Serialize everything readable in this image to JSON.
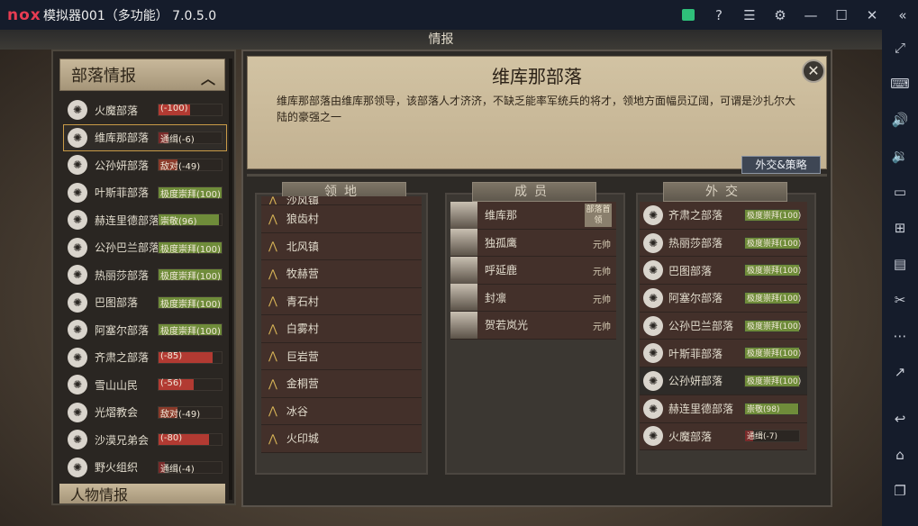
{
  "window": {
    "logo": "nox",
    "title": "模拟器001（多功能） 7.0.5.0",
    "toolbar_icons": [
      "gift-icon",
      "help-icon",
      "menu-icon",
      "settings-icon",
      "minimize-icon",
      "maximize-icon",
      "close-icon",
      "collapse-icon"
    ]
  },
  "sidebar_icons": [
    "fullscreen-icon",
    "keyboard-icon",
    "volume-up-icon",
    "volume-down-icon",
    "screen-icon",
    "apk-install-icon",
    "multi-instance-icon",
    "scissors-icon",
    "more-icon",
    "share-icon",
    "back-icon",
    "home-icon",
    "recent-apps-icon"
  ],
  "game": {
    "header": "情报",
    "left_panel": {
      "title": "部落情报",
      "next_section": "人物情报",
      "tribes": [
        {
          "name": "火魔部落",
          "relation": "(-100)",
          "color": "#b23a32",
          "level": 0.5,
          "selected": false
        },
        {
          "name": "维库那部落",
          "relation": "通缉(-6)",
          "color": "#7a2a2a",
          "level": 0.15,
          "selected": true
        },
        {
          "name": "公孙妍部落",
          "relation": "敌对(-49)",
          "color": "#8a3a2a",
          "level": 0.3,
          "selected": false
        },
        {
          "name": "叶斯菲部落",
          "relation": "极度崇拜(100)",
          "color": "#6f8c3a",
          "level": 1.0,
          "selected": false
        },
        {
          "name": "赫连里德部落",
          "relation": "崇敬(96)",
          "color": "#6f8c3a",
          "level": 0.96,
          "selected": false
        },
        {
          "name": "公孙巴兰部落",
          "relation": "极度崇拜(100)",
          "color": "#6f8c3a",
          "level": 1.0,
          "selected": false
        },
        {
          "name": "热丽莎部落",
          "relation": "极度崇拜(100)",
          "color": "#6f8c3a",
          "level": 1.0,
          "selected": false
        },
        {
          "name": "巴图部落",
          "relation": "极度崇拜(100)",
          "color": "#6f8c3a",
          "level": 1.0,
          "selected": false
        },
        {
          "name": "阿塞尔部落",
          "relation": "极度崇拜(100)",
          "color": "#6f8c3a",
          "level": 1.0,
          "selected": false
        },
        {
          "name": "齐肃之部落",
          "relation": "(-85)",
          "color": "#b23a32",
          "level": 0.85,
          "selected": false
        },
        {
          "name": "雪山山民",
          "relation": "(-56)",
          "color": "#b23a32",
          "level": 0.56,
          "selected": false
        },
        {
          "name": "光熠教会",
          "relation": "敌对(-49)",
          "color": "#8a3a2a",
          "level": 0.3,
          "selected": false
        },
        {
          "name": "沙漠兄弟会",
          "relation": "(-80)",
          "color": "#b23a32",
          "level": 0.8,
          "selected": false
        },
        {
          "name": "野火组织",
          "relation": "通缉(-4)",
          "color": "#7a2a2a",
          "level": 0.1,
          "selected": false
        }
      ]
    },
    "detail": {
      "name": "维库那部落",
      "description": "维库那部落由维库那领导，该部落人才济济，不缺乏能率军统兵的将才，领地方面幅员辽阔，可谓是沙扎尔大陆的豪强之一",
      "diplomacy_button": "外交&策略",
      "territory": {
        "title": "领地",
        "items": [
          "沙风镇",
          "狼齿村",
          "北风镇",
          "牧赫营",
          "青石村",
          "白雾村",
          "巨岩营",
          "金桐营",
          "冰谷",
          "火印城"
        ]
      },
      "members": {
        "title": "成员",
        "items": [
          {
            "name": "维库那",
            "role": "部落首领"
          },
          {
            "name": "独孤鹰",
            "role": "元帅"
          },
          {
            "name": "呼延鹿",
            "role": "元帅"
          },
          {
            "name": "封凛",
            "role": "元帅"
          },
          {
            "name": "贺若岚光",
            "role": "元帅"
          }
        ]
      },
      "foreign": {
        "title": "外交",
        "items": [
          {
            "name": "齐肃之部落",
            "relation": "极度崇拜(100)",
            "color": "#6f8c3a",
            "level": 1.0
          },
          {
            "name": "热丽莎部落",
            "relation": "极度崇拜(100)",
            "color": "#6f8c3a",
            "level": 1.0
          },
          {
            "name": "巴图部落",
            "relation": "极度崇拜(100)",
            "color": "#6f8c3a",
            "level": 1.0
          },
          {
            "name": "阿塞尔部落",
            "relation": "极度崇拜(100)",
            "color": "#6f8c3a",
            "level": 1.0
          },
          {
            "name": "公孙巴兰部落",
            "relation": "极度崇拜(100)",
            "color": "#6f8c3a",
            "level": 1.0
          },
          {
            "name": "叶斯菲部落",
            "relation": "极度崇拜(100)",
            "color": "#6f8c3a",
            "level": 1.0
          },
          {
            "name": "公孙妍部落",
            "relation": "极度崇拜(100)",
            "color": "#6f8c3a",
            "level": 1.0
          },
          {
            "name": "赫连里德部落",
            "relation": "崇敬(98)",
            "color": "#6f8c3a",
            "level": 0.98
          },
          {
            "name": "火魔部落",
            "relation": "通缉(-7)",
            "color": "#7a2a2a",
            "level": 0.15
          }
        ]
      }
    }
  }
}
